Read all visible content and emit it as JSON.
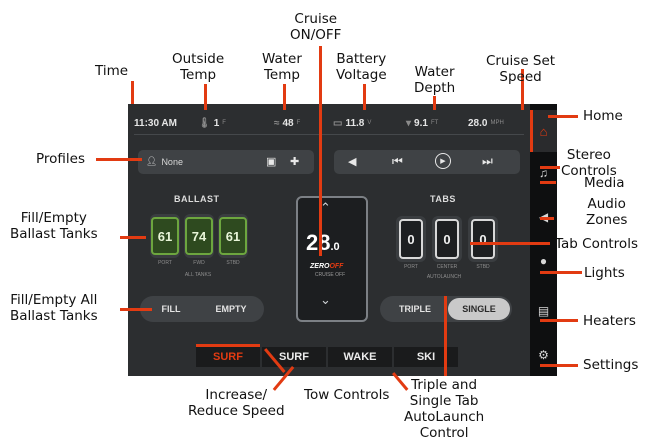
{
  "annotations": {
    "time": "Time",
    "outside_temp": [
      "Outside",
      "Temp"
    ],
    "water_temp": [
      "Water",
      "Temp"
    ],
    "cruise_toggle": [
      "Cruise",
      "ON/OFF"
    ],
    "battery_voltage": [
      "Battery",
      "Voltage"
    ],
    "water_depth": [
      "Water",
      "Depth"
    ],
    "cruise_set_speed": [
      "Cruise Set",
      "Speed"
    ],
    "home": "Home",
    "stereo_controls": [
      "Stereo",
      "Controls"
    ],
    "media": "Media",
    "audio_zones": [
      "Audio",
      "Zones"
    ],
    "tab_controls": "Tab Controls",
    "lights": "Lights",
    "heaters": "Heaters",
    "settings": "Settings",
    "profiles": "Profiles",
    "fill_empty_ballast": [
      "Fill/Empty",
      "Ballast Tanks"
    ],
    "fill_empty_all": [
      "Fill/Empty All",
      "Ballast Tanks"
    ],
    "increase_reduce": [
      "Increase/",
      "Reduce Speed"
    ],
    "tow_controls": "Tow Controls",
    "triple_single": [
      "Triple and",
      "Single Tab",
      "AutoLaunch",
      "Control"
    ]
  },
  "status_bar": {
    "time": "11:30 AM",
    "outside_temp": "1",
    "outside_temp_unit": "F",
    "water_temp": "48",
    "water_temp_unit": "F",
    "battery": "11.8",
    "battery_unit": "V",
    "depth": "9.1",
    "depth_unit": "FT",
    "cruise_speed": "28.0",
    "cruise_speed_unit": "MPH"
  },
  "profiles": {
    "name": "None"
  },
  "ballast": {
    "title": "BALLAST",
    "tanks": [
      {
        "value": "61",
        "label": "PORT"
      },
      {
        "value": "74",
        "label": "FWD"
      },
      {
        "value": "61",
        "label": "STBD"
      }
    ],
    "caption": "ALL TANKS",
    "fill_label": "FILL",
    "empty_label": "EMPTY"
  },
  "cruise": {
    "speed_main": "28",
    "speed_decimal": ".0",
    "brand_a": "ZERO",
    "brand_b": "OFF",
    "status": "CRUISE OFF"
  },
  "tabs": {
    "title": "TABS",
    "items": [
      {
        "value": "0",
        "label": "PORT"
      },
      {
        "value": "0",
        "label": "CENTER"
      },
      {
        "value": "0",
        "label": "STBD"
      }
    ],
    "caption": "AUTOLAUNCH",
    "triple_label": "TRIPLE",
    "single_label": "SINGLE"
  },
  "tow": {
    "modes": [
      "SURF",
      "SURF",
      "WAKE",
      "SKI"
    ]
  },
  "colors": {
    "accent": "#e23b12",
    "ballast_green": "#6da63f",
    "screen_bg": "#2c2e30"
  }
}
